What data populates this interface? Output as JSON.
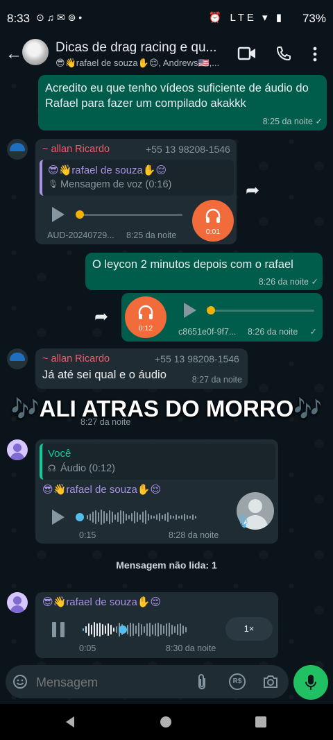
{
  "status_bar": {
    "time": "8:33",
    "battery": "73%",
    "left_icons": "⊙ ♫ ✉ ⊚ •",
    "right_icons": "⏰ LTE ▾ ▮"
  },
  "header": {
    "title": "Dicas de drag racing e qu...",
    "subtitle": "😎👋rafael de souza✋😌, Andrews🇺🇸,...",
    "back_icon": "arrow-left-icon",
    "video_icon": "video-call-icon",
    "call_icon": "phone-icon",
    "menu_icon": "more-vertical-icon"
  },
  "messages": {
    "m1": {
      "text": "Acredito eu que tenho vídeos suficiente de áudio do Rafael para fazer um compilado akakkk",
      "time": "8:25 da noite",
      "status": "✓"
    },
    "m2": {
      "sender": "~ allan Ricardo",
      "phone": "+55 13 98208-1546",
      "quote_author": "😎👋rafael de souza✋😌",
      "quote_text": "Mensagem de voz (0:16)",
      "audio_duration": "0:01",
      "file_name": "AUD-20240729...",
      "time": "8:25 da noite"
    },
    "m3": {
      "text": "O leycon 2 minutos depois com o rafael",
      "time": "8:26 da noite",
      "status": "✓"
    },
    "m4": {
      "audio_duration": "0:12",
      "file_name": "c8651e0f-9f7...",
      "time": "8:26 da noite",
      "status": "✓"
    },
    "m5": {
      "sender": "~ allan Ricardo",
      "phone": "+55 13 98208-1546",
      "text": "Já até sei qual e o áudio",
      "time": "8:27 da noite"
    },
    "m6": {
      "time_hidden": "8:27 da noite",
      "quote_author": "Você",
      "quote_text": "Áudio (0:12)",
      "sender": "😎👋rafael de souza✋😌",
      "elapsed": "0:15",
      "time": "8:28 da noite"
    },
    "m7": {
      "sender": "😎👋rafael de souza✋😌",
      "elapsed": "0:05",
      "time": "8:30 da noite",
      "speed": "1×"
    }
  },
  "overlay_caption": "🎶ALI ATRAS DO MORRO🎶",
  "unread_divider": "Mensagem não lida: 1",
  "input": {
    "placeholder": "Mensagem",
    "emoji_icon": "emoji-icon",
    "attach_icon": "attach-icon",
    "payment_icon": "R$",
    "camera_icon": "camera-icon",
    "mic_icon": "mic-icon"
  },
  "colors": {
    "accent": "#21c063",
    "outgoing": "#005c4b",
    "incoming": "#202c33",
    "audio_orange": "#f26b3a"
  }
}
